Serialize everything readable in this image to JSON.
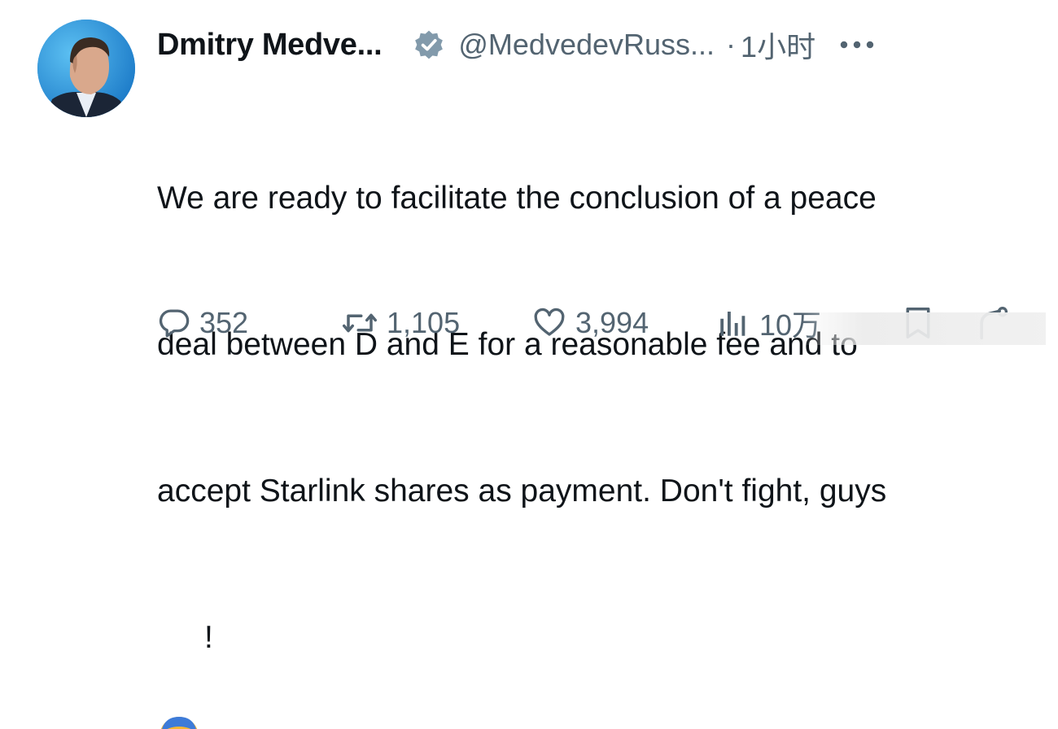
{
  "author": {
    "display_name": "Dmitry Medve...",
    "handle": "@MedvedevRuss...",
    "verified": true,
    "avatar": "avatar-photo"
  },
  "meta": {
    "separator": "·",
    "time": "1小时"
  },
  "tweet": {
    "lines": [
      "We are ready to facilitate the conclusion of a peace",
      "deal between D and E for a reasonable fee and to",
      "accept Starlink shares as payment. Don't fight, guys"
    ],
    "last_line_suffix": "!",
    "emoji": "face-screaming-in-fear-icon"
  },
  "actions": {
    "replies": "352",
    "reposts": "1,105",
    "likes": "3,994",
    "views": "10万"
  },
  "colors": {
    "text": "#0f1419",
    "secondary": "#536471",
    "verified_badge": "#829aab",
    "avatar_bg": "#2a8fd8"
  }
}
